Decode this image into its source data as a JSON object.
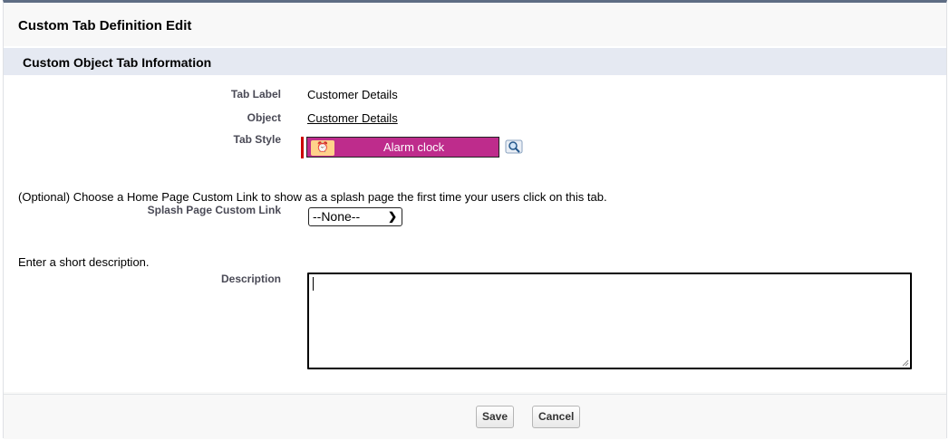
{
  "page": {
    "title": "Custom Tab Definition Edit",
    "section_title": "Custom Object Tab Information"
  },
  "fields": {
    "tab_label": {
      "label": "Tab Label",
      "value": "Customer Details"
    },
    "object": {
      "label": "Object",
      "value": "Customer Details"
    },
    "tab_style": {
      "label": "Tab Style",
      "value": "Alarm clock",
      "color": "#be2c8c",
      "icon": "alarm-clock-icon"
    },
    "splash_hint": "(Optional) Choose a Home Page Custom Link to show as a splash page the first time your users click on this tab.",
    "splash_link": {
      "label": "Splash Page Custom Link",
      "selected": "--None--"
    },
    "description_hint": "Enter a short description.",
    "description": {
      "label": "Description",
      "value": ""
    }
  },
  "footer": {
    "save_label": "Save",
    "cancel_label": "Cancel"
  }
}
